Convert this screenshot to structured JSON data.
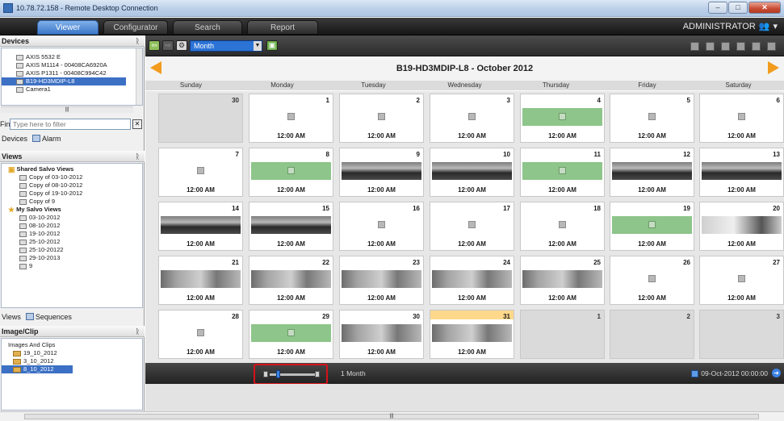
{
  "window": {
    "title": "10.78.72.158 - Remote Desktop Connection"
  },
  "header": {
    "tabs": [
      {
        "label": "Viewer",
        "active": true
      },
      {
        "label": "Configurator",
        "active": false
      },
      {
        "label": "Search",
        "active": false
      },
      {
        "label": "Report",
        "active": false
      }
    ],
    "user": "ADMINISTRATOR"
  },
  "left": {
    "devices_header": "Devices",
    "devices": [
      {
        "label": "AXIS 5532 E",
        "selected": false
      },
      {
        "label": "AXIS M1114 - 00408CA6920A",
        "selected": false
      },
      {
        "label": "AXIS P1311 - 00408C994C42",
        "selected": false
      },
      {
        "label": "B19-HD3MDIP-L8",
        "selected": true
      },
      {
        "label": "Camera1",
        "selected": false
      }
    ],
    "filter_label": "Find",
    "filter_placeholder": "Type here to filter",
    "device_tabs": [
      "Devices",
      "Alarm"
    ],
    "views_header": "Views",
    "shared_salvo": "Shared Salvo Views",
    "shared_items": [
      "Copy of 03-10-2012",
      "Copy of 08-10-2012",
      "Copy of 19-10-2012",
      "Copy of 9"
    ],
    "my_salvo": "My Salvo Views",
    "my_items": [
      "03-10-2012",
      "08-10-2012",
      "19-10-2012",
      "25-10-2012",
      "25-10-20122",
      "29-10-2013",
      "9"
    ],
    "view_tabs": [
      "Views",
      "Sequences"
    ],
    "clips_header": "Image/Clip",
    "clips_root": "Images And Clips",
    "clips": [
      {
        "label": "19_10_2012",
        "selected": false
      },
      {
        "label": "3_10_2012",
        "selected": false
      },
      {
        "label": "8_10_2012",
        "selected": true
      }
    ]
  },
  "toolbar": {
    "period": "Month"
  },
  "calendar": {
    "title": "B19-HD3MDIP-L8 -  October 2012",
    "weekdays": [
      "Sunday",
      "Monday",
      "Tuesday",
      "Wednesday",
      "Thursday",
      "Friday",
      "Saturday"
    ],
    "weeks": [
      [
        {
          "day": "30",
          "kind": "empty"
        },
        {
          "day": "1",
          "kind": "blank",
          "time": "12:00 AM"
        },
        {
          "day": "2",
          "kind": "blank",
          "time": "12:00 AM"
        },
        {
          "day": "3",
          "kind": "blank",
          "time": "12:00 AM"
        },
        {
          "day": "4",
          "kind": "green",
          "time": "12:00 AM"
        },
        {
          "day": "5",
          "kind": "blank",
          "time": "12:00 AM"
        },
        {
          "day": "6",
          "kind": "blank",
          "time": "12:00 AM"
        }
      ],
      [
        {
          "day": "7",
          "kind": "blank",
          "time": "12:00 AM"
        },
        {
          "day": "8",
          "kind": "green",
          "time": "12:00 AM"
        },
        {
          "day": "9",
          "kind": "cam",
          "time": "12:00 AM"
        },
        {
          "day": "10",
          "kind": "cam",
          "time": "12:00 AM"
        },
        {
          "day": "11",
          "kind": "green",
          "time": "12:00 AM"
        },
        {
          "day": "12",
          "kind": "cam",
          "time": "12:00 AM"
        },
        {
          "day": "13",
          "kind": "cam",
          "time": "12:00 AM"
        }
      ],
      [
        {
          "day": "14",
          "kind": "cam",
          "time": "12:00 AM"
        },
        {
          "day": "15",
          "kind": "cam",
          "time": "12:00 AM"
        },
        {
          "day": "16",
          "kind": "blank",
          "time": "12:00 AM"
        },
        {
          "day": "17",
          "kind": "blank",
          "time": "12:00 AM"
        },
        {
          "day": "18",
          "kind": "blank",
          "time": "12:00 AM"
        },
        {
          "day": "19",
          "kind": "green",
          "time": "12:00 AM"
        },
        {
          "day": "20",
          "kind": "cam3",
          "time": "12:00 AM"
        }
      ],
      [
        {
          "day": "21",
          "kind": "cam2",
          "time": "12:00 AM"
        },
        {
          "day": "22",
          "kind": "cam2",
          "time": "12:00 AM"
        },
        {
          "day": "23",
          "kind": "cam2",
          "time": "12:00 AM"
        },
        {
          "day": "24",
          "kind": "cam2",
          "time": "12:00 AM"
        },
        {
          "day": "25",
          "kind": "cam2",
          "time": "12:00 AM"
        },
        {
          "day": "26",
          "kind": "blank",
          "time": "12:00 AM"
        },
        {
          "day": "27",
          "kind": "blank",
          "time": "12:00 AM"
        }
      ],
      [
        {
          "day": "28",
          "kind": "blank",
          "time": "12:00 AM"
        },
        {
          "day": "29",
          "kind": "green",
          "time": "12:00 AM"
        },
        {
          "day": "30",
          "kind": "cam2",
          "time": "12:00 AM"
        },
        {
          "day": "31",
          "kind": "cam2",
          "time": "12:00 AM",
          "today": true
        },
        {
          "day": "1",
          "kind": "empty"
        },
        {
          "day": "2",
          "kind": "empty"
        },
        {
          "day": "3",
          "kind": "empty"
        }
      ]
    ]
  },
  "bottom": {
    "range": "1 Month",
    "datetime": "09-Oct-2012 00:00:00"
  }
}
